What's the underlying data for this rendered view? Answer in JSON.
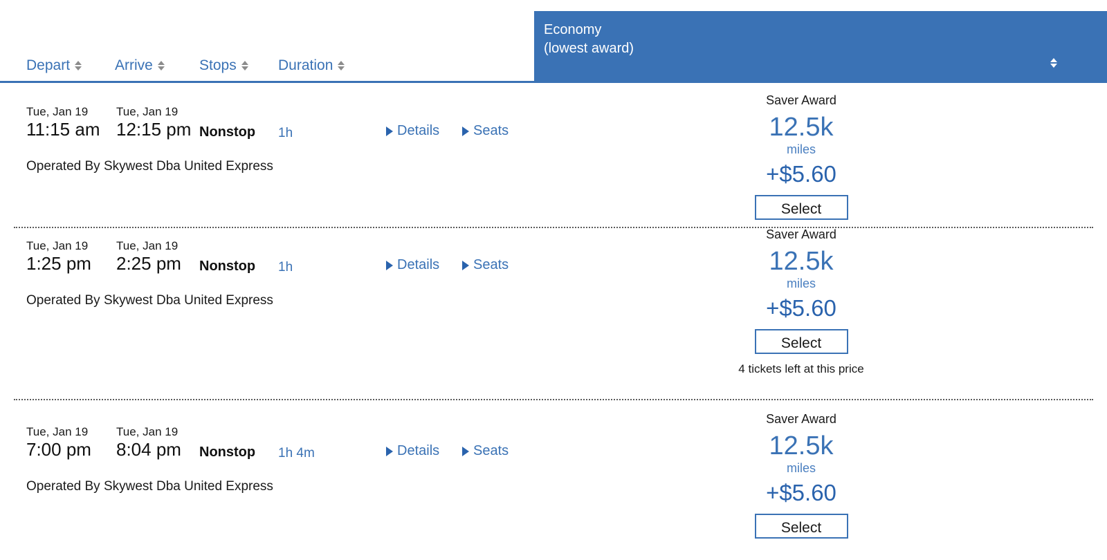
{
  "columns": [
    {
      "key": "depart",
      "label": "Depart",
      "sort_icon": "sort-updown-icon"
    },
    {
      "key": "arrive",
      "label": "Arrive",
      "sort_icon": "sort-updown-icon"
    },
    {
      "key": "stops",
      "label": "Stops",
      "sort_icon": "sort-updown-icon"
    },
    {
      "key": "duration",
      "label": "Duration",
      "sort_icon": "sort-updown-icon"
    }
  ],
  "fare_header": {
    "title": "Economy",
    "subtitle": "(lowest award)",
    "sort_icon": "sort-updown-icon",
    "background_color": "#3a72b5",
    "text_color": "#ffffff"
  },
  "links": {
    "details_label": "Details",
    "seats_label": "Seats",
    "details_icon": "triangle-right-icon",
    "seats_icon": "triangle-right-icon"
  },
  "accent_color": "#3a72b5",
  "flights": [
    {
      "depart_date": "Tue, Jan 19",
      "depart_time": "11:15 am",
      "arrive_date": "Tue, Jan 19",
      "arrive_time": "12:15 pm",
      "stops": "Nonstop",
      "duration": "1h",
      "operated_by": "Operated By Skywest Dba United Express",
      "fare": {
        "award_label": "Saver Award",
        "miles": "12.5k",
        "miles_unit": "miles",
        "cash": "+$5.60",
        "select_label": "Select",
        "tickets_left": ""
      }
    },
    {
      "depart_date": "Tue, Jan 19",
      "depart_time": "1:25 pm",
      "arrive_date": "Tue, Jan 19",
      "arrive_time": "2:25 pm",
      "stops": "Nonstop",
      "duration": "1h",
      "operated_by": "Operated By Skywest Dba United Express",
      "fare": {
        "award_label": "Saver Award",
        "miles": "12.5k",
        "miles_unit": "miles",
        "cash": "+$5.60",
        "select_label": "Select",
        "tickets_left": "4 tickets left at this price"
      }
    },
    {
      "depart_date": "Tue, Jan 19",
      "depart_time": "7:00 pm",
      "arrive_date": "Tue, Jan 19",
      "arrive_time": "8:04 pm",
      "stops": "Nonstop",
      "duration": "1h 4m",
      "operated_by": "Operated By Skywest Dba United Express",
      "fare": {
        "award_label": "Saver Award",
        "miles": "12.5k",
        "miles_unit": "miles",
        "cash": "+$5.60",
        "select_label": "Select",
        "tickets_left": ""
      }
    }
  ]
}
